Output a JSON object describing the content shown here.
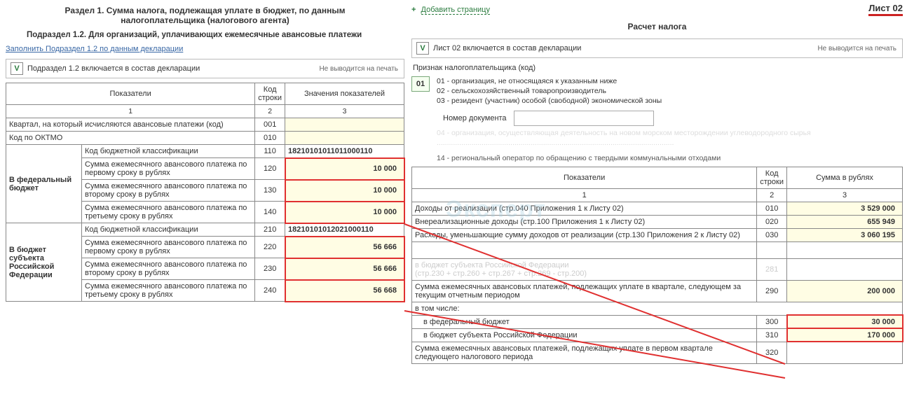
{
  "left": {
    "title": "Раздел 1. Сумма налога, подлежащая уплате в бюджет, по данным налогоплательщика (налогового агента)",
    "subtitle": "Подраздел 1.2. Для организаций, уплачивающих ежемесячные авансовые платежи",
    "fill_link": "Заполнить Подраздел 1.2 по данным декларации",
    "include_checkbox": "V",
    "include_label": "Подраздел 1.2 включается в состав декларации",
    "noprint": "Не выводится на печать",
    "headers": {
      "col1": "Показатели",
      "col2": "Код строки",
      "col3": "Значения показателей"
    },
    "sub": {
      "c1": "1",
      "c2": "2",
      "c3": "3"
    },
    "rows": {
      "kvartal": {
        "label": "Квартал, на который исчисляются авансовые платежи (код)",
        "code": "001"
      },
      "oktmo": {
        "label": "Код по ОКТМО",
        "code": "010"
      },
      "fed_header": "В федеральный бюджет",
      "fed_kbk": {
        "label": "Код бюджетной классификации",
        "code": "110",
        "value": "18210101011011000110"
      },
      "fed_s1": {
        "label": "Сумма ежемесячного авансового платежа по первому сроку в рублях",
        "code": "120",
        "value": "10 000"
      },
      "fed_s2": {
        "label": "Сумма ежемесячного авансового платежа по второму сроку в рублях",
        "code": "130",
        "value": "10 000"
      },
      "fed_s3": {
        "label": "Сумма ежемесячного авансового платежа по третьему сроку в рублях",
        "code": "140",
        "value": "10 000"
      },
      "subj_header": "В бюджет субъекта Российской Федерации",
      "subj_kbk": {
        "label": "Код бюджетной классификации",
        "code": "210",
        "value": "18210101012021000110"
      },
      "subj_s1": {
        "label": "Сумма ежемесячного авансового платежа по первому сроку в рублях",
        "code": "220",
        "value": "56 666"
      },
      "subj_s2": {
        "label": "Сумма ежемесячного авансового платежа по второму сроку в рублях",
        "code": "230",
        "value": "56 666"
      },
      "subj_s3": {
        "label": "Сумма ежемесячного авансового платежа по третьему сроку в рублях",
        "code": "240",
        "value": "56 668"
      }
    }
  },
  "right": {
    "add_page": "Добавить страницу",
    "sheet_label": "Лист 02",
    "title": "Расчет налога",
    "include_checkbox": "V",
    "include_label": "Лист 02 включается в состав декларации",
    "noprint": "Не выводится на печать",
    "taxcode_label": "Признак налогоплательщика (код)",
    "taxcode_value": "01",
    "taxcode_list": {
      "l1": "01 - организация, не относящаяся к указанным ниже",
      "l2": "02 - сельскохозяйственный товаропроизводитель",
      "l3": "03 - резидент (участник) особой (свободной) экономической зоны"
    },
    "docnum_label": "Номер документа",
    "faded_04": "04 - организация, осуществляющая деятельность на новом морском месторождении углеводородного сырья",
    "reg_hint": "14 - региональный оператор по обращению с твердыми коммунальными отходами",
    "headers": {
      "col1": "Показатели",
      "col2": "Код строки",
      "col3": "Сумма в рублях"
    },
    "sub": {
      "c1": "1",
      "c2": "2",
      "c3": "3"
    },
    "rows": {
      "r010": {
        "label": "Доходы от реализации (стр.040 Приложения 1 к Листу 02)",
        "code": "010",
        "value": "3 529 000"
      },
      "r020": {
        "label": "Внереализационные доходы (стр.100 Приложения 1 к Листу 02)",
        "code": "020",
        "value": "655 949"
      },
      "r030": {
        "label": "Расходы, уменьшающие сумму доходов от реализации (стр.130 Приложения 2 к Листу 02)",
        "code": "030",
        "value": "3 060 195"
      },
      "ghost1": "в бюджет субъекта Российской Федерации",
      "ghost2": "(стр.230 + стр.260 + стр.267 + стр.269 - стр.200)",
      "r281_code": "281",
      "r290": {
        "label": "Сумма ежемесячных авансовых платежей, подлежащих уплате в квартале, следующем за текущим отчетным периодом",
        "code": "290",
        "value": "200 000"
      },
      "incl": "в том числе:",
      "r300": {
        "label": "в федеральный бюджет",
        "code": "300",
        "value": "30 000"
      },
      "r310": {
        "label": "в бюджет субъекта Российской Федерации",
        "code": "310",
        "value": "170 000"
      },
      "r320": {
        "label": "Сумма ежемесячных авансовых платежей, подлежащих уплате в первом квартале следующего налогового периода",
        "code": "320"
      }
    }
  }
}
